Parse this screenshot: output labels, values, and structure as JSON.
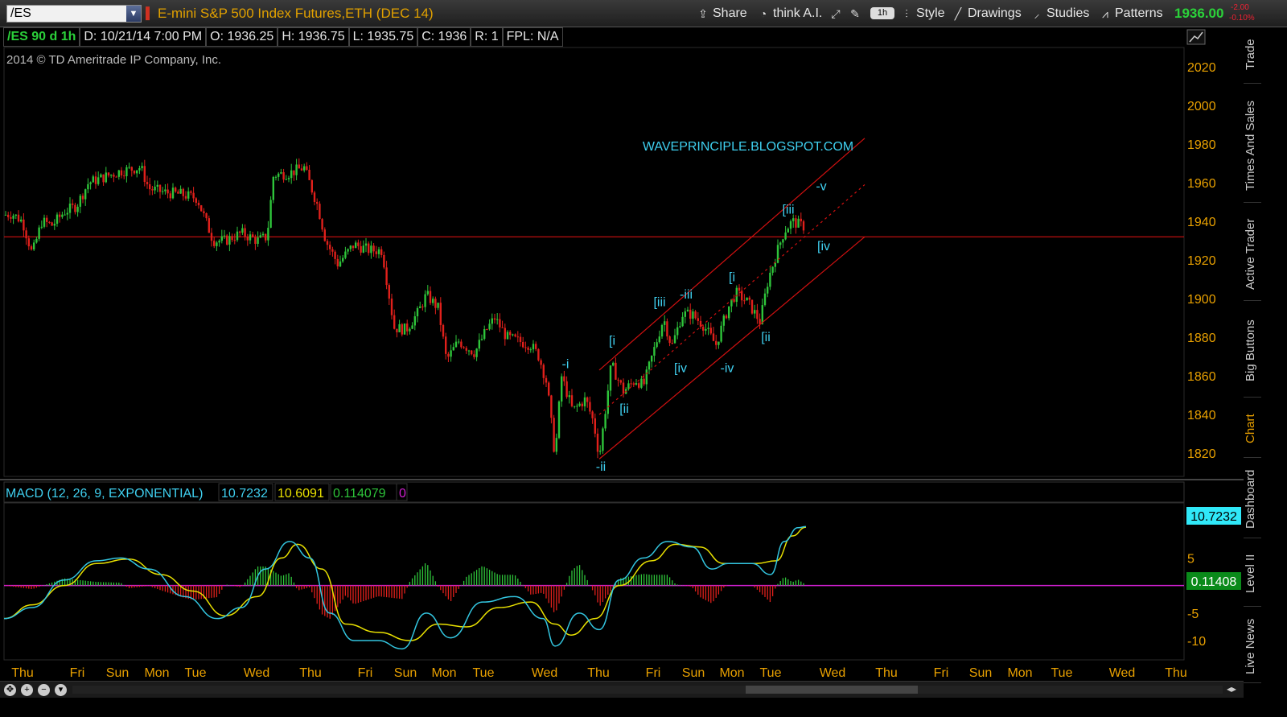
{
  "toolbar": {
    "symbol": "/ES",
    "description": "E-mini S&P 500 Index Futures,ETH (DEC 14)",
    "share_label": "Share",
    "think_label": "think A.I.",
    "timeframe_pill": "1h",
    "style_label": "Style",
    "drawings_label": "Drawings",
    "studies_label": "Studies",
    "patterns_label": "Patterns",
    "last_price": "1936.00",
    "change": "-2.00",
    "change_pct": "-0.10%",
    "icons": [
      "share-icon",
      "think-icon",
      "tools-icon",
      "wrench-icon",
      "style-icon",
      "drawings-icon",
      "studies-icon",
      "patterns-icon"
    ]
  },
  "info_bar": {
    "symbol_period": "/ES 90 d 1h",
    "date": "D: 10/21/14 7:00 PM",
    "open": "O: 1936.25",
    "high": "H: 1936.75",
    "low": "L: 1935.75",
    "close": "C: 1936",
    "range": "R: 1",
    "fpl": "FPL: N/A"
  },
  "copyright": "2014 © TD Ameritrade IP Company, Inc.",
  "watermark": "WAVEPRINCIPLE.BLOGSPOT.COM",
  "side_tabs": [
    "Trade",
    "Times And Sales",
    "Active Trader",
    "Big Buttons",
    "Chart",
    "Dashboard",
    "Level II",
    "Live News"
  ],
  "active_side_tab": "Chart",
  "colors": {
    "up": "#2ec43a",
    "down": "#e0201b",
    "accent": "#e8a000",
    "cyan": "#3fd0f0",
    "macd_line": "#33c6e0",
    "signal_line": "#e8e000",
    "zero": "#d020d0",
    "hline": "#d01010"
  },
  "chart_data": [
    {
      "type": "candlestick",
      "title": "E-mini S&P 500 Index Futures,ETH (DEC 14)",
      "ylim": [
        1808,
        2030
      ],
      "y_ticks": [
        1820,
        1840,
        1860,
        1880,
        1900,
        1920,
        1940,
        1960,
        1980,
        2000,
        2020
      ],
      "x_labels": [
        "Thu",
        "Fri",
        "Sun",
        "Mon",
        "Tue",
        "Wed",
        "Thu",
        "Fri",
        "Sun",
        "Mon",
        "Tue",
        "Wed",
        "Thu",
        "Fri",
        "Sun",
        "Mon",
        "Tue",
        "Wed",
        "Thu",
        "Fri",
        "Sun",
        "Mon",
        "Tue",
        "Wed",
        "Thu"
      ],
      "horizontal_line": 1932,
      "price_path": [
        [
          0,
          1943
        ],
        [
          15,
          1944
        ],
        [
          28,
          1940
        ],
        [
          40,
          1923
        ],
        [
          52,
          1940
        ],
        [
          65,
          1938
        ],
        [
          80,
          1945
        ],
        [
          95,
          1948
        ],
        [
          110,
          1960
        ],
        [
          130,
          1963
        ],
        [
          150,
          1966
        ],
        [
          175,
          1968
        ],
        [
          185,
          1957
        ],
        [
          205,
          1955
        ],
        [
          225,
          1954
        ],
        [
          245,
          1952
        ],
        [
          265,
          1930
        ],
        [
          280,
          1930
        ],
        [
          300,
          1934
        ],
        [
          320,
          1930
        ],
        [
          332,
          1932
        ],
        [
          340,
          1964
        ],
        [
          360,
          1965
        ],
        [
          378,
          1968
        ],
        [
          395,
          1948
        ],
        [
          405,
          1930
        ],
        [
          420,
          1918
        ],
        [
          440,
          1928
        ],
        [
          460,
          1925
        ],
        [
          475,
          1925
        ],
        [
          490,
          1885
        ],
        [
          505,
          1884
        ],
        [
          520,
          1893
        ],
        [
          530,
          1902
        ],
        [
          545,
          1895
        ],
        [
          555,
          1868
        ],
        [
          570,
          1878
        ],
        [
          590,
          1872
        ],
        [
          605,
          1884
        ],
        [
          615,
          1890
        ],
        [
          630,
          1880
        ],
        [
          645,
          1878
        ],
        [
          660,
          1876
        ],
        [
          670,
          1870
        ],
        [
          680,
          1856
        ],
        [
          690,
          1818
        ],
        [
          698,
          1860
        ],
        [
          712,
          1842
        ],
        [
          728,
          1848
        ],
        [
          738,
          1836
        ],
        [
          745,
          1818
        ],
        [
          760,
          1866
        ],
        [
          775,
          1852
        ],
        [
          790,
          1858
        ],
        [
          800,
          1855
        ],
        [
          812,
          1872
        ],
        [
          825,
          1890
        ],
        [
          835,
          1875
        ],
        [
          848,
          1892
        ],
        [
          860,
          1892
        ],
        [
          875,
          1886
        ],
        [
          890,
          1876
        ],
        [
          905,
          1895
        ],
        [
          915,
          1903
        ],
        [
          930,
          1898
        ],
        [
          945,
          1888
        ],
        [
          955,
          1910
        ],
        [
          965,
          1923
        ],
        [
          975,
          1935
        ],
        [
          985,
          1940
        ],
        [
          995,
          1938
        ],
        [
          1002,
          1937
        ]
      ],
      "channel": {
        "upper": [
          [
            745,
            1863
          ],
          [
            1075,
            1983
          ]
        ],
        "lower": [
          [
            745,
            1817
          ],
          [
            1075,
            1932
          ]
        ],
        "mid": [
          [
            745,
            1840
          ],
          [
            1075,
            1959
          ]
        ]
      },
      "wave_labels": [
        {
          "text": "-i",
          "x": 703,
          "price": 1864
        },
        {
          "text": "-ii",
          "x": 747,
          "price": 1811
        },
        {
          "text": "[i",
          "x": 761,
          "price": 1876
        },
        {
          "text": "[ii",
          "x": 776,
          "price": 1841
        },
        {
          "text": "[iii",
          "x": 820,
          "price": 1896
        },
        {
          "text": "-iii",
          "x": 853,
          "price": 1900
        },
        {
          "text": "[iv",
          "x": 846,
          "price": 1862
        },
        {
          "text": "-iv",
          "x": 904,
          "price": 1862
        },
        {
          "text": "[i",
          "x": 910,
          "price": 1909
        },
        {
          "text": "[ii",
          "x": 952,
          "price": 1878
        },
        {
          "text": "[iii",
          "x": 980,
          "price": 1944
        },
        {
          "text": "-v",
          "x": 1021,
          "price": 1956
        },
        {
          "text": "[iv",
          "x": 1024,
          "price": 1925
        }
      ]
    },
    {
      "type": "line",
      "title": "MACD (12, 26, 9, EXPONENTIAL)",
      "legend_values": [
        "10.7232",
        "10.6091",
        "0.114079",
        "0"
      ],
      "ylim": [
        -13.5,
        15
      ],
      "y_ticks": [
        5,
        -5,
        -10
      ],
      "value_label": "10.7232",
      "diff_label": "0.11408",
      "macd": [
        [
          5,
          -6
        ],
        [
          40,
          -4
        ],
        [
          80,
          1
        ],
        [
          120,
          4.5
        ],
        [
          150,
          5
        ],
        [
          185,
          3
        ],
        [
          230,
          -2
        ],
        [
          270,
          -6
        ],
        [
          300,
          -4
        ],
        [
          330,
          3
        ],
        [
          360,
          8
        ],
        [
          385,
          5
        ],
        [
          410,
          -5
        ],
        [
          440,
          -10
        ],
        [
          470,
          -10
        ],
        [
          500,
          -11.5
        ],
        [
          530,
          -5
        ],
        [
          560,
          -9.5
        ],
        [
          600,
          -3
        ],
        [
          640,
          -2
        ],
        [
          675,
          -6
        ],
        [
          690,
          -11
        ],
        [
          720,
          -5
        ],
        [
          745,
          -8
        ],
        [
          770,
          1
        ],
        [
          800,
          5
        ],
        [
          830,
          8
        ],
        [
          860,
          7
        ],
        [
          885,
          3
        ],
        [
          905,
          4
        ],
        [
          935,
          4
        ],
        [
          958,
          2
        ],
        [
          975,
          8
        ],
        [
          992,
          10.5
        ],
        [
          1002,
          10.7
        ]
      ],
      "signal": [
        [
          5,
          -6
        ],
        [
          40,
          -3.5
        ],
        [
          80,
          0
        ],
        [
          120,
          4
        ],
        [
          160,
          4.8
        ],
        [
          200,
          2
        ],
        [
          240,
          -1
        ],
        [
          280,
          -5.5
        ],
        [
          320,
          -2
        ],
        [
          350,
          5
        ],
        [
          370,
          7.5
        ],
        [
          400,
          3
        ],
        [
          430,
          -7
        ],
        [
          470,
          -8.5
        ],
        [
          510,
          -10
        ],
        [
          545,
          -7
        ],
        [
          580,
          -7.5
        ],
        [
          620,
          -4
        ],
        [
          660,
          -3
        ],
        [
          690,
          -7
        ],
        [
          710,
          -9
        ],
        [
          740,
          -6
        ],
        [
          770,
          0
        ],
        [
          810,
          4.5
        ],
        [
          840,
          7.5
        ],
        [
          870,
          7
        ],
        [
          900,
          4
        ],
        [
          940,
          4
        ],
        [
          965,
          4.5
        ],
        [
          985,
          9
        ],
        [
          1002,
          10.6
        ]
      ]
    }
  ]
}
